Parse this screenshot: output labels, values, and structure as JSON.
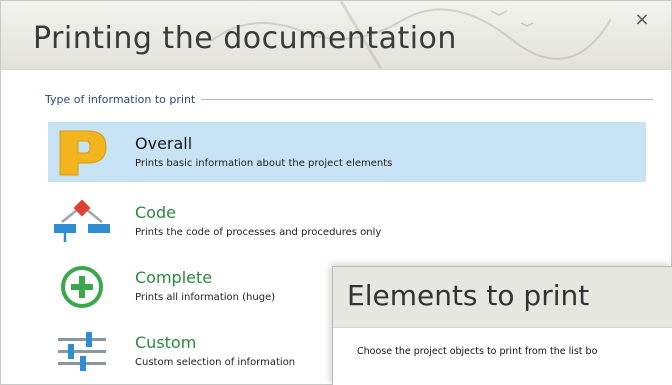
{
  "dialog": {
    "title": "Printing the documentation",
    "close_glyph": "×"
  },
  "group": {
    "label": "Type of information to print"
  },
  "options": [
    {
      "title": "Overall",
      "description": "Prints basic information about the project elements",
      "icon": "p-letter-icon",
      "selected": true
    },
    {
      "title": "Code",
      "description": "Prints the code of processes and procedures only",
      "icon": "code-diagram-icon",
      "selected": false
    },
    {
      "title": "Complete",
      "description": "Prints all information (huge)",
      "icon": "plus-circle-icon",
      "selected": false
    },
    {
      "title": "Custom",
      "description": "Custom selection of information",
      "icon": "sliders-icon",
      "selected": false
    }
  ],
  "overlay": {
    "title": "Elements to print",
    "instruction": "Choose the project objects to print from the list bo"
  },
  "colors": {
    "selection": "#c8e2f6",
    "accent_green": "#2a8a3c",
    "icon_yellow": "#f2b51e",
    "icon_blue": "#2f8ed3",
    "icon_red": "#e0402f",
    "label_blue": "#2b4b7a"
  }
}
